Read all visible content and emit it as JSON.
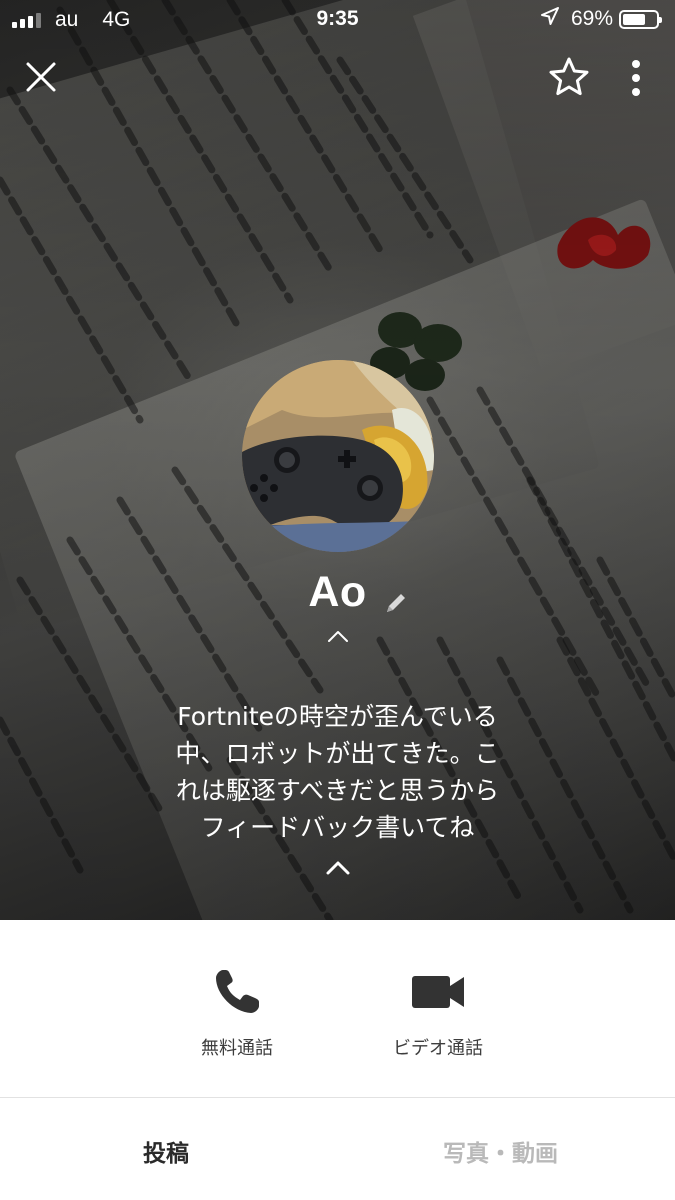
{
  "status_bar": {
    "carrier": "au",
    "network": "4G",
    "time": "9:35",
    "battery_percent": "69%",
    "battery_level": 0.69,
    "signal_bars_filled": 3,
    "signal_bars_total": 4
  },
  "header": {
    "close_icon": "close-icon",
    "favorite_icon": "star-icon",
    "more_icon": "more-vertical-icon"
  },
  "profile": {
    "name": "Ao",
    "edit_icon": "pencil-icon",
    "status_message_lines": [
      "Fortniteの時空が歪んでいる",
      "中、ロボットが出てきた。こ",
      "れは駆逐すべきだと思うから",
      "フィードバック書いてね"
    ]
  },
  "actions": {
    "free_call": {
      "label": "無料通話",
      "icon": "phone-icon"
    },
    "video_call": {
      "label": "ビデオ通話",
      "icon": "video-camera-icon"
    }
  },
  "tabs": [
    {
      "label": "投稿",
      "active": true
    },
    {
      "label": "写真・動画",
      "active": false
    }
  ],
  "colors": {
    "icon_dark": "#333333",
    "tab_active": "#2a2a2a",
    "tab_inactive": "#b9b9b9",
    "status_text": "#ffffff"
  }
}
